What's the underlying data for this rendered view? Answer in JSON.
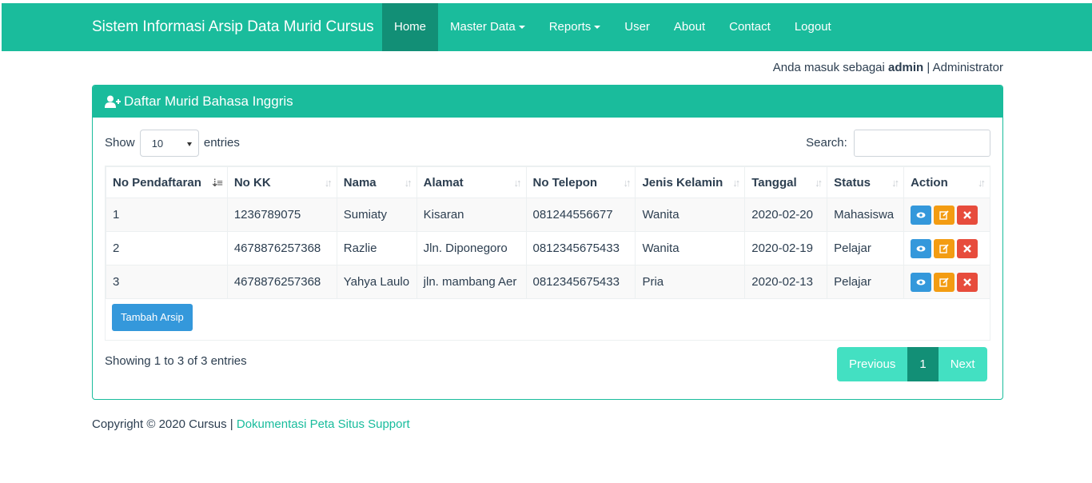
{
  "navbar": {
    "brand": "Sistem Informasi Arsip Data Murid Cursus",
    "items": [
      "Home",
      "Master Data",
      "Reports",
      "User",
      "About",
      "Contact",
      "Logout"
    ]
  },
  "login": {
    "prefix": "Anda masuk sebagai",
    "user": "admin",
    "sep": "|",
    "role": "Administrator"
  },
  "panel": {
    "title": "Daftar Murid Bahasa Inggris"
  },
  "controls": {
    "show": "Show",
    "entries_value": "10",
    "entries": "entries",
    "search": "Search:"
  },
  "table": {
    "headers": [
      "No Pendaftaran",
      "No KK",
      "Nama",
      "Alamat",
      "No Telepon",
      "Jenis Kelamin",
      "Tanggal",
      "Status",
      "Action"
    ],
    "rows": [
      [
        "1",
        "1236789075",
        "Sumiaty",
        "Kisaran",
        "081244556677",
        "Wanita",
        "2020-02-20",
        "Mahasiswa"
      ],
      [
        "2",
        "4678876257368",
        "Razlie",
        "Jln. Diponegoro",
        "0812345675433",
        "Wanita",
        "2020-02-19",
        "Pelajar"
      ],
      [
        "3",
        "4678876257368",
        "Yahya Laulo",
        "jln. mambang Aer",
        "0812345675433",
        "Pria",
        "2020-02-13",
        "Pelajar"
      ]
    ]
  },
  "add_button": "Tambah Arsip",
  "info": "Showing 1 to 3 of 3 entries",
  "pagination": {
    "prev": "Previous",
    "current": "1",
    "next": "Next"
  },
  "footer": {
    "copyright": "Copyright © 2020 Cursus |",
    "links": "Dokumentasi Peta Situs Support"
  },
  "colors": {
    "primary": "#1abc9c",
    "dark": "#128f76",
    "info": "#3498db",
    "warning": "#f39c12",
    "danger": "#e74c3c"
  }
}
